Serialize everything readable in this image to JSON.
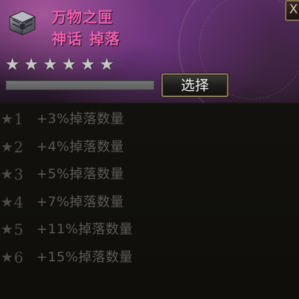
{
  "item": {
    "name": "万物之匣",
    "rarity": "神话",
    "category": "掉落",
    "star_count": 6,
    "icon": "chest-icon"
  },
  "progress": {
    "fraction": 0.0
  },
  "buttons": {
    "select_label": "选择",
    "close_label": "X"
  },
  "levels": [
    {
      "star": "★",
      "level": "1",
      "bonus": "+3%掉落数量"
    },
    {
      "star": "★",
      "level": "2",
      "bonus": "+4%掉落数量"
    },
    {
      "star": "★",
      "level": "3",
      "bonus": "+5%掉落数量"
    },
    {
      "star": "★",
      "level": "4",
      "bonus": "+7%掉落数量"
    },
    {
      "star": "★",
      "level": "5",
      "bonus": "+11%掉落数量"
    },
    {
      "star": "★",
      "level": "6",
      "bonus": "+15%掉落数量"
    }
  ],
  "colors": {
    "title": "#f05fb0",
    "star_active": "#c6c6c6",
    "row_text": "#5a5955"
  }
}
